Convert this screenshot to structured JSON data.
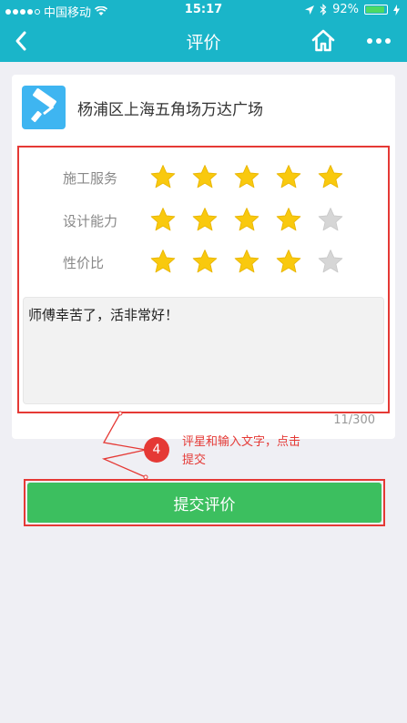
{
  "status_bar": {
    "carrier": "中国移动",
    "time": "15:17",
    "battery_text": "92%",
    "battery_level": 0.92,
    "signal_dots_filled": 4,
    "signal_dots_total": 5
  },
  "nav": {
    "title": "评价",
    "back_icon": "chevron-left-icon",
    "home_icon": "home-icon",
    "more_icon": "more-dots-icon"
  },
  "shop": {
    "icon": "paint-roller-icon",
    "name": "杨浦区上海五角场万达广场"
  },
  "ratings": [
    {
      "label": "施工服务",
      "stars": 5,
      "max": 5
    },
    {
      "label": "设计能力",
      "stars": 4,
      "max": 5
    },
    {
      "label": "性价比",
      "stars": 4,
      "max": 5
    }
  ],
  "comment": {
    "text": "师傅幸苦了，活非常好！",
    "counter": "11/300"
  },
  "annotation": {
    "step": "4",
    "text": "评星和输入文字，点击提交"
  },
  "submit": {
    "label": "提交评价"
  },
  "colors": {
    "brand": "#1ab5c9",
    "star_on": "#f9c90e",
    "star_off": "#d6d6d6",
    "submit": "#3cbf5f",
    "annotation": "#e53935"
  }
}
